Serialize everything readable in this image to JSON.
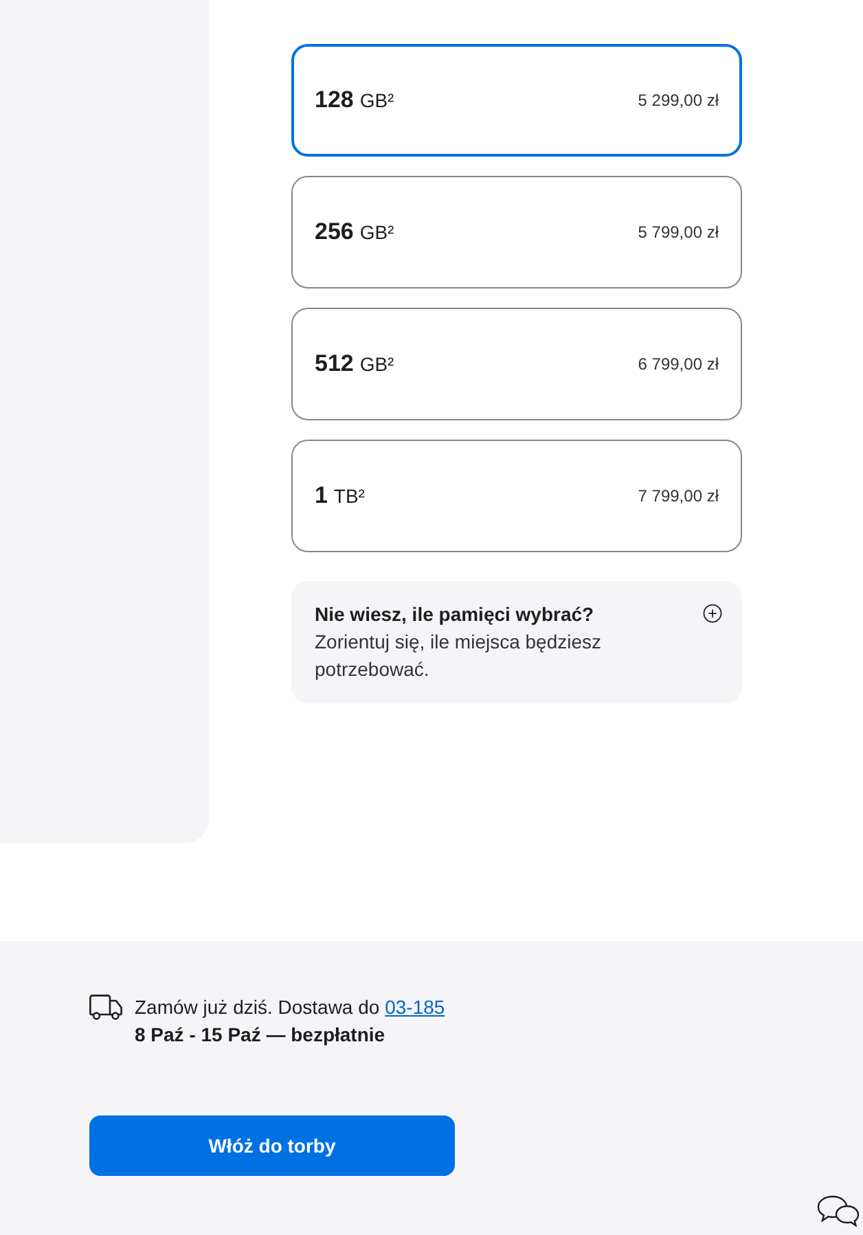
{
  "storage_options": [
    {
      "capacity": "128",
      "unit": "GB²",
      "price": "5 299,00 zł",
      "selected": true
    },
    {
      "capacity": "256",
      "unit": "GB²",
      "price": "5 799,00 zł",
      "selected": false
    },
    {
      "capacity": "512",
      "unit": "GB²",
      "price": "6 799,00 zł",
      "selected": false
    },
    {
      "capacity": "1",
      "unit": "TB²",
      "price": "7 799,00 zł",
      "selected": false
    }
  ],
  "help_box": {
    "title": "Nie wiesz, ile pamięci wybrać?",
    "text": "Zorientuj się, ile miejsca będziesz potrzebować."
  },
  "delivery": {
    "text": "Zamów już dziś. Dostawa do",
    "postcode_link": "03-185",
    "dates": "8 Paź - 15 Paź — bezpłatnie"
  },
  "add_to_bag_button": "Włóż do torby"
}
